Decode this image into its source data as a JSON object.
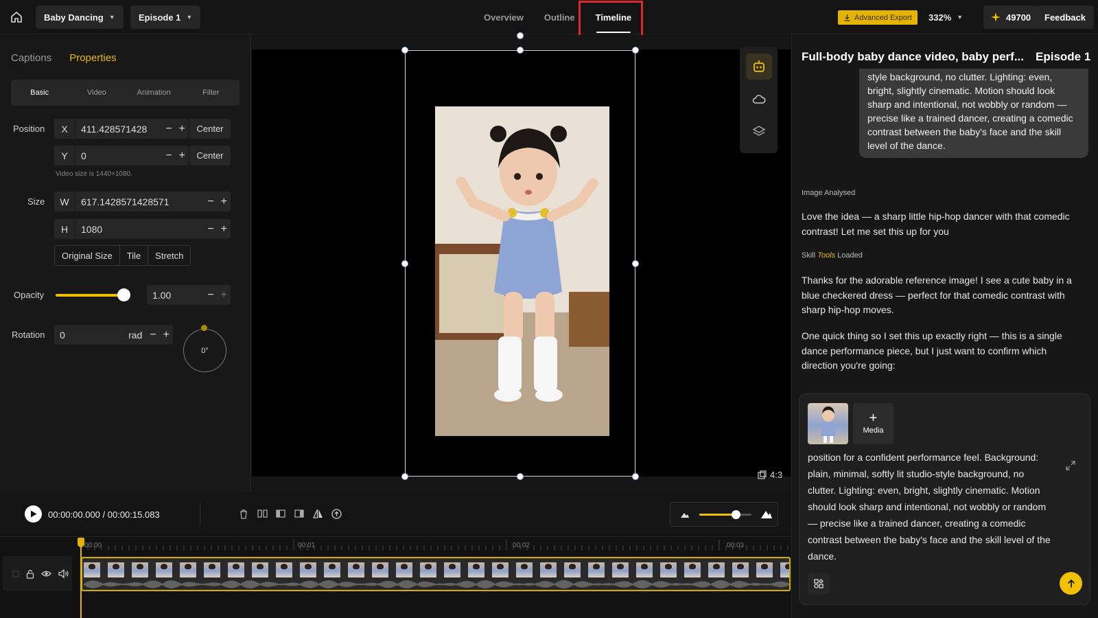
{
  "header": {
    "project_name": "Baby Dancing",
    "episode": "Episode 1",
    "tabs": [
      {
        "label": "Overview"
      },
      {
        "label": "Outline"
      },
      {
        "label": "Timeline"
      }
    ],
    "active_tab": "Timeline",
    "advanced_export": "Advanced Export",
    "zoom": "332%",
    "credits": "49700",
    "feedback": "Feedback"
  },
  "left_panel": {
    "tabs": {
      "captions": "Captions",
      "properties": "Properties"
    },
    "subtabs": [
      "Basic",
      "Video",
      "Animation",
      "Filter"
    ],
    "position": {
      "label": "Position",
      "x_axis": "X",
      "x_value": "411.428571428",
      "y_axis": "Y",
      "y_value": "0",
      "center": "Center",
      "hint": "Video size is 1440×1080."
    },
    "size": {
      "label": "Size",
      "w_axis": "W",
      "w_value": "617.1428571428571",
      "h_axis": "H",
      "h_value": "1080",
      "modes": [
        "Original Size",
        "Tile",
        "Stretch"
      ]
    },
    "opacity": {
      "label": "Opacity",
      "value": "1.00",
      "level": 1.0
    },
    "rotation": {
      "label": "Rotation",
      "value": "0",
      "unit": "rad",
      "dial": "0°"
    }
  },
  "canvas": {
    "aspect_ratio": "4:3"
  },
  "playback": {
    "current_time": "00:00:00.000",
    "total_time": "00:00:15.083",
    "separator": " / "
  },
  "timeline": {
    "ticks": [
      "00:00",
      "00:01",
      "00:02",
      "00:03"
    ],
    "zoom_level": 0.7
  },
  "chat": {
    "title": "Full-body baby dance video, baby perf...",
    "episode": "Episode 1",
    "user_message": "style background, no clutter. Lighting: even, bright, slightly cinematic. Motion should look sharp and intentional, not wobbly or random — precise like a trained dancer, creating a comedic contrast between the baby's face and the skill level of the dance.",
    "status_image": "Image Analysed",
    "reply_1": "Love the idea — a sharp little hip-hop dancer with that comedic contrast! Let me set this up for you",
    "status_skill_prefix": "Skill",
    "status_skill_tools": "Tools",
    "status_skill_suffix": "Loaded",
    "reply_2": "Thanks for the adorable reference image! I see a cute baby in a blue checkered dress — perfect for that comedic contrast with sharp hip-hop moves.",
    "reply_3": "One quick thing so I set this up exactly right — this is a single dance performance piece, but I just want to confirm which direction you're going:",
    "composer": {
      "media_label": "Media",
      "text": "position for a confident performance feel. Background: plain, minimal, softly lit studio-style background, no clutter. Lighting: even, bright, slightly cinematic. Motion should look sharp and intentional, not wobbly or random — precise like a trained dancer, creating a comedic contrast between the baby's face and the skill level of the dance."
    }
  },
  "colors": {
    "accent": "#e9b800",
    "highlight_box": "#e0262b",
    "send_button": "#f2c200"
  }
}
